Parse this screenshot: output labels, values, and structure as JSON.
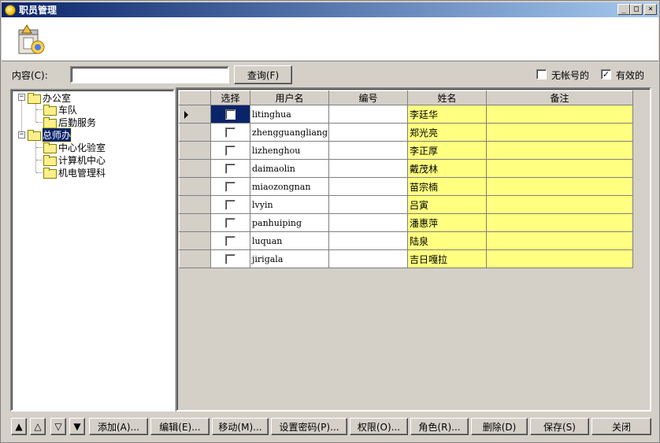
{
  "window": {
    "title": "职员管理",
    "controls": [
      "_",
      "□",
      "×"
    ]
  },
  "search": {
    "label": "内容(C):",
    "value": "",
    "query_button": "查询(F)"
  },
  "filters": [
    {
      "label": "无帐号的",
      "checked": false
    },
    {
      "label": "有效的",
      "checked": true
    }
  ],
  "tree": {
    "nodes": [
      {
        "label": "办公室",
        "level": 0,
        "expanded": true,
        "selected": false
      },
      {
        "label": "车队",
        "level": 1,
        "selected": false
      },
      {
        "label": "后勤服务",
        "level": 1,
        "selected": false
      },
      {
        "label": "总师办",
        "level": 0,
        "expanded": true,
        "selected": true
      },
      {
        "label": "中心化验室",
        "level": 1,
        "selected": false
      },
      {
        "label": "计算机中心",
        "level": 1,
        "selected": false
      },
      {
        "label": "机电管理科",
        "level": 1,
        "selected": false
      }
    ]
  },
  "table": {
    "columns": [
      "选择",
      "用户名",
      "编号",
      "姓名",
      "备注"
    ],
    "rows": [
      {
        "selected": false,
        "username": "litinghua",
        "number": "",
        "name": "李廷华",
        "note": ""
      },
      {
        "selected": false,
        "username": "zhengguangliang",
        "number": "",
        "name": "郑光亮",
        "note": ""
      },
      {
        "selected": false,
        "username": "lizhenghou",
        "number": "",
        "name": "李正厚",
        "note": ""
      },
      {
        "selected": false,
        "username": "daimaolin",
        "number": "",
        "name": "戴茂林",
        "note": ""
      },
      {
        "selected": false,
        "username": "miaozongnan",
        "number": "",
        "name": "苗宗楠",
        "note": ""
      },
      {
        "selected": false,
        "username": "lvyin",
        "number": "",
        "name": "吕寅",
        "note": ""
      },
      {
        "selected": false,
        "username": "panhuiping",
        "number": "",
        "name": "潘惠萍",
        "note": ""
      },
      {
        "selected": false,
        "username": "luquan",
        "number": "",
        "name": "陆泉",
        "note": ""
      },
      {
        "selected": false,
        "username": "jirigala",
        "number": "",
        "name": "吉日嘎拉",
        "note": ""
      }
    ]
  },
  "nav_buttons": [
    "▲",
    "△",
    "▽",
    "▼"
  ],
  "actions": {
    "add": "添加(A)...",
    "edit": "编辑(E)...",
    "move": "移动(M)...",
    "set_password": "设置密码(P)...",
    "permissions": "权限(O)...",
    "roles": "角色(R)...",
    "delete": "删除(D)",
    "save": "保存(S)",
    "close": "关闭"
  }
}
